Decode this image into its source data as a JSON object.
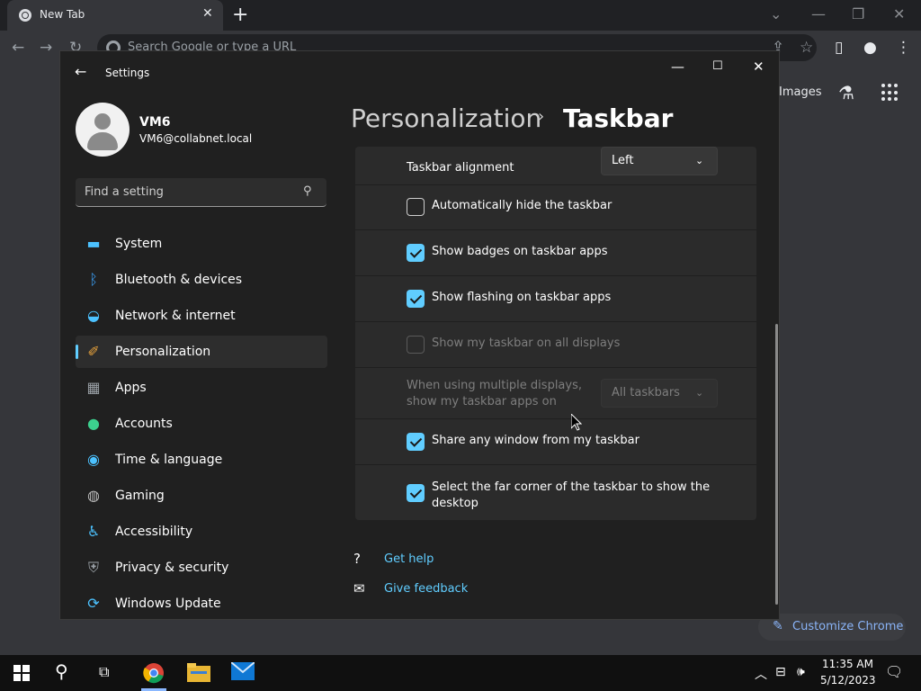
{
  "chrome": {
    "tab_title": "New Tab",
    "omnibox_placeholder": "Search Google or type a URL",
    "images_link": "Images",
    "customize_label": "Customize Chrome"
  },
  "settings": {
    "window_title": "Settings",
    "user": {
      "name": "VM6",
      "email": "VM6@collabnet.local"
    },
    "search_placeholder": "Find a setting",
    "nav": [
      {
        "label": "System",
        "icon": "monitor-icon",
        "color": "#4cc2ff"
      },
      {
        "label": "Bluetooth & devices",
        "icon": "bluetooth-icon",
        "color": "#0078d4"
      },
      {
        "label": "Network & internet",
        "icon": "wifi-icon",
        "color": "#4cc2ff"
      },
      {
        "label": "Personalization",
        "icon": "brush-icon",
        "color": "#e8a33d"
      },
      {
        "label": "Apps",
        "icon": "apps-icon",
        "color": "#9aa0a6"
      },
      {
        "label": "Accounts",
        "icon": "person-icon",
        "color": "#3ccf8e"
      },
      {
        "label": "Time & language",
        "icon": "globe-clock-icon",
        "color": "#4cc2ff"
      },
      {
        "label": "Gaming",
        "icon": "gamepad-icon",
        "color": "#bdbdbd"
      },
      {
        "label": "Accessibility",
        "icon": "accessibility-icon",
        "color": "#4cc2ff"
      },
      {
        "label": "Privacy & security",
        "icon": "shield-icon",
        "color": "#9aa0a6"
      },
      {
        "label": "Windows Update",
        "icon": "refresh-icon",
        "color": "#4cc2ff"
      }
    ],
    "active_nav": "Personalization",
    "breadcrumb": {
      "parent": "Personalization",
      "current": "Taskbar"
    },
    "taskbar_alignment": {
      "label": "Taskbar alignment",
      "value": "Left"
    },
    "options": [
      {
        "label": "Automatically hide the taskbar",
        "checked": false,
        "disabled": false
      },
      {
        "label": "Show badges on taskbar apps",
        "checked": true,
        "disabled": false
      },
      {
        "label": "Show flashing on taskbar apps",
        "checked": true,
        "disabled": false
      },
      {
        "label": "Show my taskbar on all displays",
        "checked": false,
        "disabled": true
      }
    ],
    "multi_display": {
      "label_line1": "When using multiple displays,",
      "label_line2": "show my taskbar apps on",
      "value": "All taskbars"
    },
    "share_window": "Share any window from my taskbar",
    "far_corner_line1": "Select the far corner of the taskbar to show the",
    "far_corner_line2": "desktop",
    "get_help": "Get help",
    "give_feedback": "Give feedback"
  },
  "taskbar": {
    "time": "11:35 AM",
    "date": "5/12/2023"
  }
}
